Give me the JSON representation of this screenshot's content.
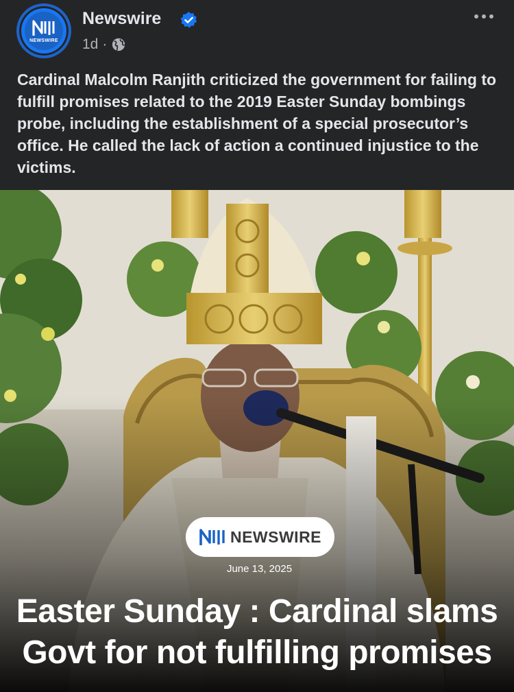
{
  "post": {
    "page_name": "Newswire",
    "avatar_text": "NEWSWIRE",
    "time": "1d",
    "separator": "·",
    "audience_icon": "globe-icon",
    "verified_icon": "verified-badge-icon",
    "more_icon": "more-options-icon",
    "caption": "Cardinal Malcolm Ranjith criticized the government for failing to fulfill promises related to the 2019 Easter Sunday bombings probe, including the establishment of a special prosecutor’s office. He called the lack of action a continued injustice to the victims."
  },
  "media": {
    "brand_label": "NEWSWIRE",
    "date": "June 13, 2025",
    "headline": "Easter Sunday : Cardinal slams Govt for not fulfilling promises"
  },
  "colors": {
    "background": "#242526",
    "text_primary": "#e4e6eb",
    "text_secondary": "#b0b3b8",
    "verified_blue": "#1877f2",
    "brand_blue": "#1a63c5"
  }
}
